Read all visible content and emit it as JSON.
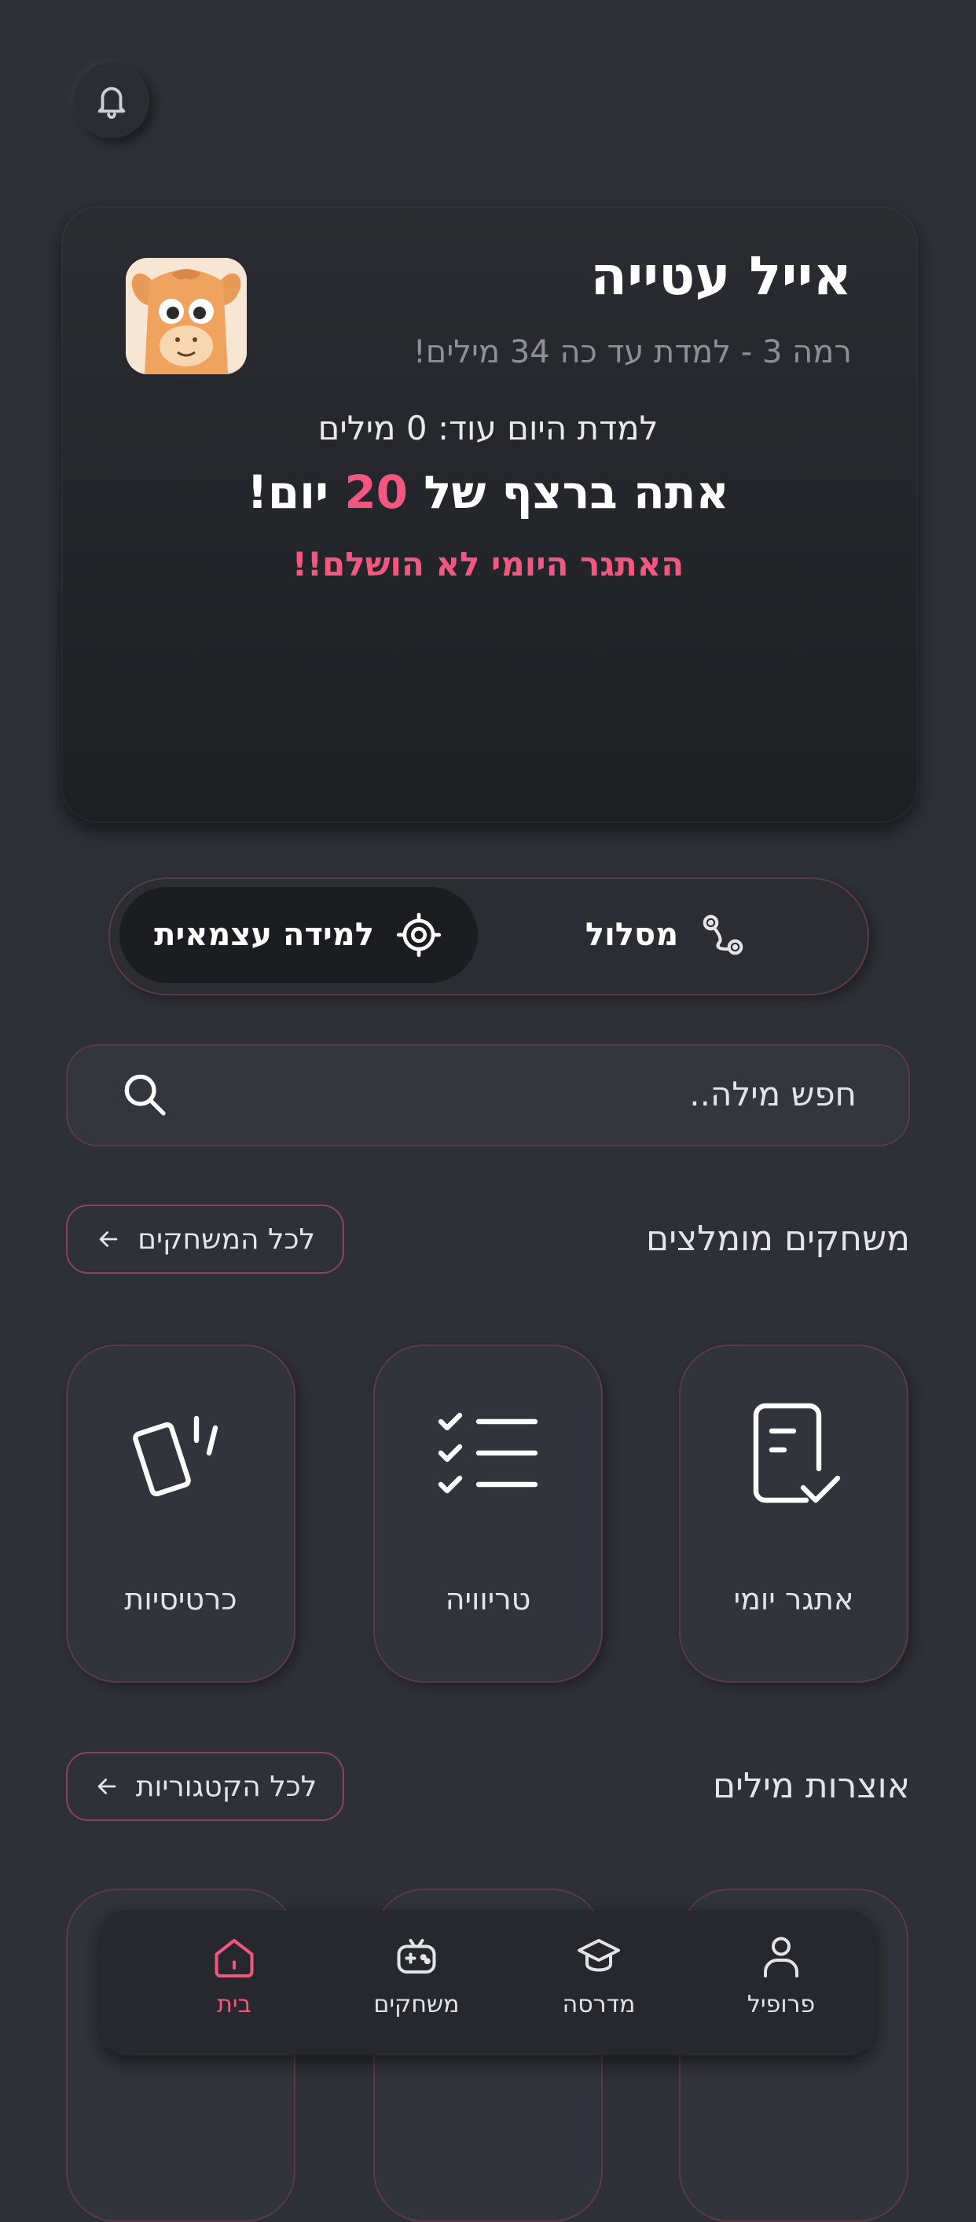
{
  "header": {
    "notifications_icon": "bell-icon"
  },
  "profile": {
    "name": "אייל עטייה",
    "level_text": "רמה 3 - למדת עד כה 34 מילים!",
    "today_text": "למדת היום עוד: 0 מילים",
    "streak_prefix": "אתה ברצף של",
    "streak_days": "20",
    "streak_suffix": "יום!",
    "challenge_status": "האתגר היומי לא הושלם!!",
    "avatar_icon": "camel-avatar"
  },
  "mode_toggle": {
    "path_label": "מסלול",
    "self_label": "למידה עצמאית",
    "selected": "self_learning"
  },
  "search": {
    "placeholder": "חפש מילה.."
  },
  "recommended_games": {
    "title": "משחקים מומלצים",
    "all_button": "לכל המשחקים",
    "items": [
      {
        "label": "אתגר יומי",
        "icon": "daily-challenge-icon"
      },
      {
        "label": "טריוויה",
        "icon": "checklist-icon"
      },
      {
        "label": "כרטיסיות",
        "icon": "cards-icon"
      }
    ]
  },
  "vocabulary": {
    "title": "אוצרות מילים",
    "all_button": "לכל הקטגוריות"
  },
  "bottom_nav": {
    "items": [
      {
        "label": "פרופיל",
        "icon": "person-icon"
      },
      {
        "label": "מדרסה",
        "icon": "graduation-cap-icon"
      },
      {
        "label": "משחקים",
        "icon": "gamepad-icon"
      },
      {
        "label": "בית",
        "icon": "home-icon"
      }
    ],
    "active": "בית"
  },
  "colors": {
    "accent": "#f2587f",
    "background": "#2e3037"
  }
}
